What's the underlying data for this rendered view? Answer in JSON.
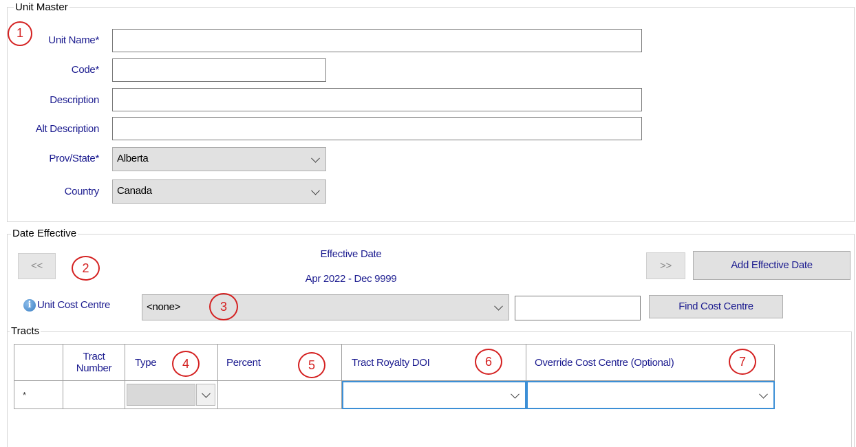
{
  "unit_master": {
    "legend": "Unit Master",
    "unit_name_label": "Unit Name*",
    "code_label": "Code*",
    "description_label": "Description",
    "alt_description_label": "Alt Description",
    "prov_state_label": "Prov/State*",
    "country_label": "Country",
    "unit_name_value": "",
    "code_value": "",
    "description_value": "",
    "alt_description_value": "",
    "prov_state_value": "Alberta",
    "country_value": "Canada"
  },
  "date_effective": {
    "legend": "Date Effective",
    "prev_label": "<<",
    "next_label": ">>",
    "effective_date_title": "Effective Date",
    "effective_date_range": "Apr 2022 - Dec 9999",
    "add_button_label": "Add Effective Date",
    "info_icon": "info-icon",
    "unit_cost_centre_label": "Unit Cost Centre",
    "cost_centre_value": "<none>",
    "cost_centre_search_value": "",
    "find_button_label": "Find Cost Centre"
  },
  "tracts": {
    "legend": "Tracts",
    "columns": [
      "",
      "Tract Number",
      "Type",
      "Percent",
      "Tract Royalty DOI",
      "Override Cost Centre (Optional)"
    ],
    "new_row_marker": "*"
  },
  "annotations": [
    "1",
    "2",
    "3",
    "4",
    "5",
    "6",
    "7"
  ],
  "colors": {
    "label_blue": "#1b1b8f",
    "annotation_red": "#d42020",
    "focus_blue": "#3c8fd6",
    "info_blue": "#3b7fc4"
  }
}
